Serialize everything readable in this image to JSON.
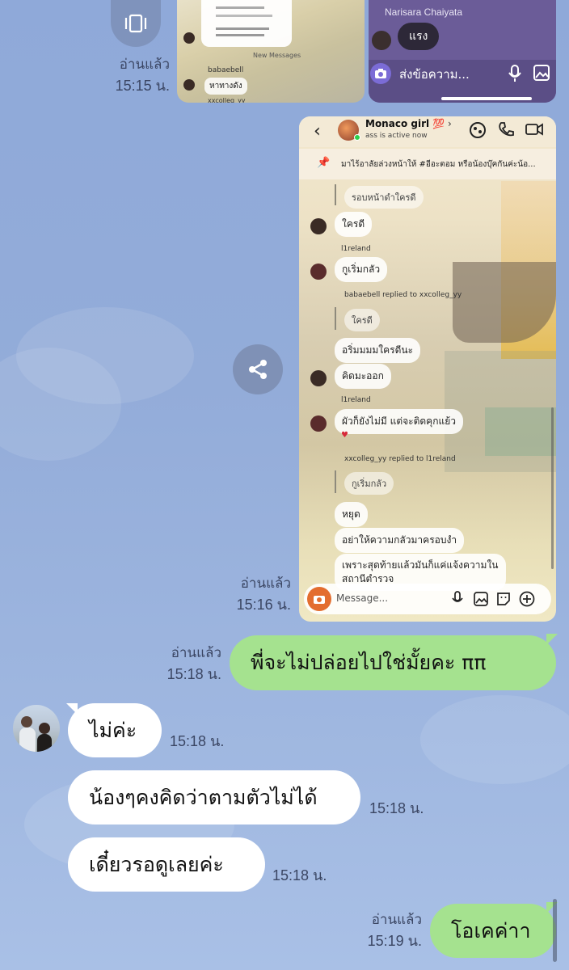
{
  "colors": {
    "background": "#93acd9",
    "bubble_incoming": "#ffffff",
    "bubble_outgoing": "#a5e28f",
    "meta_text": "#3b4663"
  },
  "top_images": {
    "left_image": {
      "labels": [
        "babaebell",
        "หาทางดัง",
        "New Messages",
        "xxcolleg_yy"
      ]
    },
    "right_image": {
      "sender_name": "Narisara Chaiyata",
      "message": "แรง",
      "input_placeholder": "ส่งข้อความ..."
    },
    "read_status": "อ่านแล้ว",
    "time": "15:15 น."
  },
  "screenshot_message": {
    "read_status": "อ่านแล้ว",
    "time": "15:16 น.",
    "header": {
      "title": "Monaco girl 💯",
      "subtitle": "ass is active now"
    },
    "pinned": "มาไร้อาลัยล่วงหน้าให้ #อีอะตอม หรือน้องบุ๊คกันค่ะน้อ...",
    "messages": [
      {
        "type": "reply",
        "text": "รอบหน้าดำใครดี"
      },
      {
        "type": "msg",
        "text": "ใครดี"
      },
      {
        "type": "name",
        "text": "l1reland"
      },
      {
        "type": "msg",
        "text": "กูเริ่มกลัว"
      },
      {
        "type": "name",
        "text": "babaebell replied to xxcolleg_yy"
      },
      {
        "type": "reply",
        "text": "ใครดี"
      },
      {
        "type": "msg",
        "text": "อริ่มมมมใครดีนะ"
      },
      {
        "type": "msg",
        "text": "คิดมะออก"
      },
      {
        "type": "name",
        "text": "l1reland"
      },
      {
        "type": "msg",
        "text": "ผัวก็ยังไม่มี แต่จะติดคุกแย้ว"
      },
      {
        "type": "name",
        "text": "xxcolleg_yy replied to l1reland"
      },
      {
        "type": "reply",
        "text": "กูเริ่มกลัว"
      },
      {
        "type": "msg",
        "text": "หยุด"
      },
      {
        "type": "msg",
        "text": "อย่าให้ความกลัวมาครอบงำ"
      },
      {
        "type": "msg",
        "text": "เพราะสุดท้ายแล้วมันก็แค่แจ้งความใน"
      },
      {
        "type": "msg",
        "text": "สถานีตำรวจ"
      }
    ],
    "input_placeholder": "Message..."
  },
  "messages": [
    {
      "direction": "out",
      "text": "พี่จะไม่ปล่อยไปใช่มั้ยคะ ππ",
      "read_status": "อ่านแล้ว",
      "time": "15:18 น."
    },
    {
      "direction": "in",
      "text": "ไม่ค่ะ",
      "time": "15:18 น."
    },
    {
      "direction": "in",
      "text": "น้องๆคงคิดว่าตามตัวไม่ได้",
      "time": "15:18 น."
    },
    {
      "direction": "in",
      "text": "เดี๋ยวรอดูเลยค่ะ",
      "time": "15:18 น."
    },
    {
      "direction": "out",
      "text": "โอเคค่าา",
      "read_status": "อ่านแล้ว",
      "time": "15:19 น."
    }
  ],
  "icons": {
    "top_button": "carousel-icon",
    "share_button": "share-icon"
  }
}
